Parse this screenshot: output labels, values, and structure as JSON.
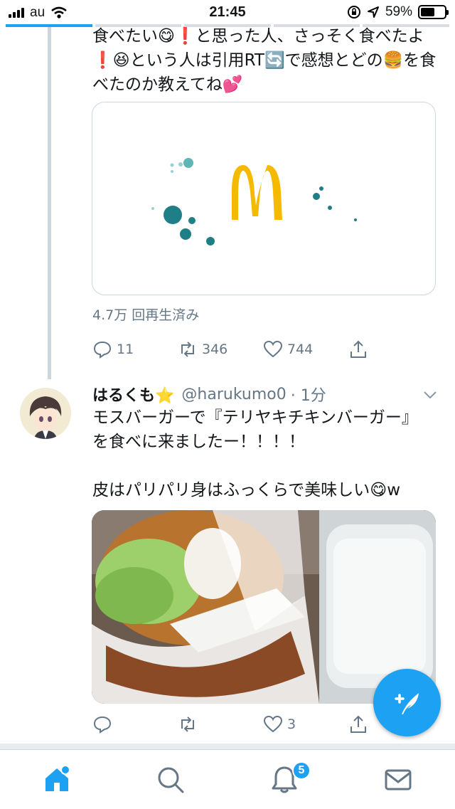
{
  "status_bar": {
    "carrier": "au",
    "time": "21:45",
    "battery": "59%",
    "battery_level": 0.59
  },
  "tweet1": {
    "text": "食べたい😋❗と思った人、さっそく食べたよ❗😆という人は引用RT🔄で感想とどの🍔を食べたのか教えてね💕",
    "media_logo": "mcdonalds-golden-arches",
    "views": "4.7万 回再生済み",
    "replies": "11",
    "retweets": "346",
    "likes": "744"
  },
  "tweet2": {
    "name": "はるくも⭐",
    "handle": "@harukumo0",
    "time": "· 1分",
    "text": "モスバーガーで『テリヤキチキンバーガー』を食べに来ましたー！！！！\n\n皮はパリパリ身はふっくらで美味しい😋w",
    "replies": "",
    "retweets": "",
    "likes": "3"
  },
  "tab_bar": {
    "notification_badge": "5"
  },
  "colors": {
    "accent": "#1da1f2",
    "gray_text": "#657786",
    "line": "#ccd6dd"
  }
}
